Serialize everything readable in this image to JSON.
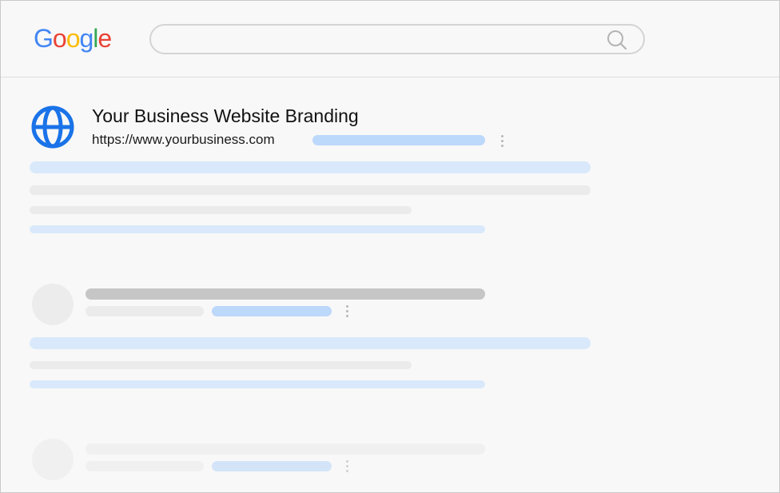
{
  "brand": {
    "logo_letters": [
      "G",
      "o",
      "o",
      "g",
      "l",
      "e"
    ],
    "logo_colors": [
      "#4285F4",
      "#EA4335",
      "#FBBC05",
      "#4285F4",
      "#34A853",
      "#EA4335"
    ]
  },
  "search": {
    "value": ""
  },
  "result": {
    "title": "Your Business Website Branding",
    "url": "https://www.yourbusiness.com",
    "icon": "globe-icon",
    "accent": "#1a73e8"
  }
}
